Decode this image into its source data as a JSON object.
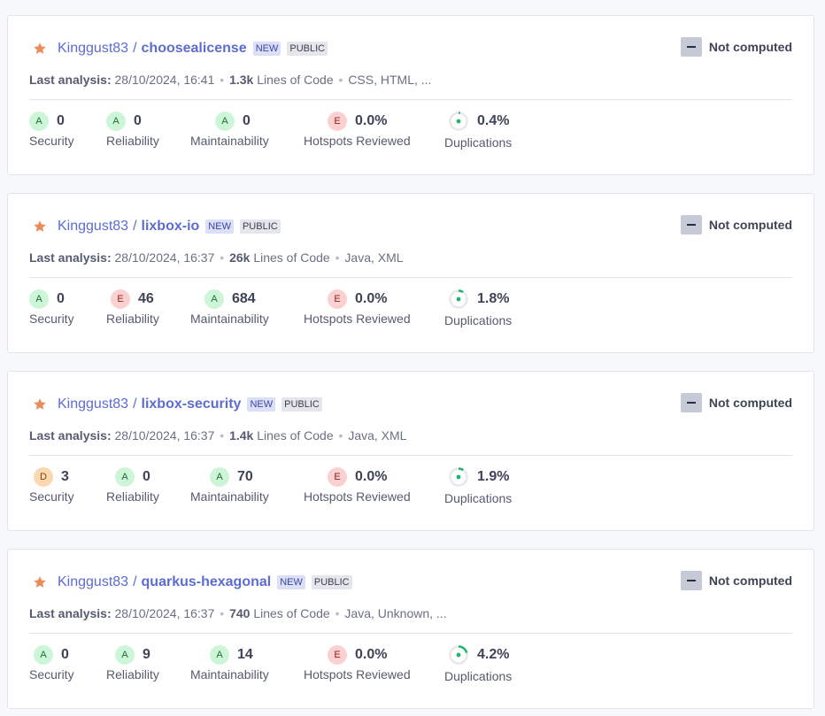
{
  "labels": {
    "security": "Security",
    "reliability": "Reliability",
    "maintainability": "Maintainability",
    "hotspots": "Hotspots Reviewed",
    "duplications": "Duplications",
    "last_analysis": "Last analysis:",
    "loc": "Lines of Code",
    "quality_gate": "Not computed",
    "badge_new": "NEW",
    "badge_public": "PUBLIC"
  },
  "colors": {
    "link": "#5d6cd0",
    "star": "#ec8a5a",
    "rating_a": "#cdf5d8",
    "rating_e": "#fbd0d0",
    "rating_d": "#fcd8b0",
    "dup_green": "#1fb56b"
  },
  "icons": {
    "favorite": "star-icon",
    "quality_gate": "dash-icon",
    "duplication": "donut-icon"
  },
  "projects": [
    {
      "owner": "Kinggust83",
      "separator": "/",
      "name": "choosealicense",
      "analysis_date": "28/10/2024, 16:41",
      "loc": "1.3k",
      "languages": "CSS, HTML, ...",
      "security": {
        "rating": "A",
        "value": "0"
      },
      "reliability": {
        "rating": "A",
        "value": "0"
      },
      "maintainability": {
        "rating": "A",
        "value": "0"
      },
      "hotspots": {
        "rating": "E",
        "value": "0.0%"
      },
      "duplications": {
        "value": "0.4%",
        "percent": 0.4
      }
    },
    {
      "owner": "Kinggust83",
      "separator": "/",
      "name": "lixbox-io",
      "analysis_date": "28/10/2024, 16:37",
      "loc": "26k",
      "languages": "Java, XML",
      "security": {
        "rating": "A",
        "value": "0"
      },
      "reliability": {
        "rating": "E",
        "value": "46"
      },
      "maintainability": {
        "rating": "A",
        "value": "684"
      },
      "hotspots": {
        "rating": "E",
        "value": "0.0%"
      },
      "duplications": {
        "value": "1.8%",
        "percent": 1.8
      }
    },
    {
      "owner": "Kinggust83",
      "separator": "/",
      "name": "lixbox-security",
      "analysis_date": "28/10/2024, 16:37",
      "loc": "1.4k",
      "languages": "Java, XML",
      "security": {
        "rating": "D",
        "value": "3"
      },
      "reliability": {
        "rating": "A",
        "value": "0"
      },
      "maintainability": {
        "rating": "A",
        "value": "70"
      },
      "hotspots": {
        "rating": "E",
        "value": "0.0%"
      },
      "duplications": {
        "value": "1.9%",
        "percent": 1.9
      }
    },
    {
      "owner": "Kinggust83",
      "separator": "/",
      "name": "quarkus-hexagonal",
      "analysis_date": "28/10/2024, 16:37",
      "loc": "740",
      "languages": "Java, Unknown, ...",
      "security": {
        "rating": "A",
        "value": "0"
      },
      "reliability": {
        "rating": "A",
        "value": "9"
      },
      "maintainability": {
        "rating": "A",
        "value": "14"
      },
      "hotspots": {
        "rating": "E",
        "value": "0.0%"
      },
      "duplications": {
        "value": "4.2%",
        "percent": 4.2
      }
    }
  ]
}
